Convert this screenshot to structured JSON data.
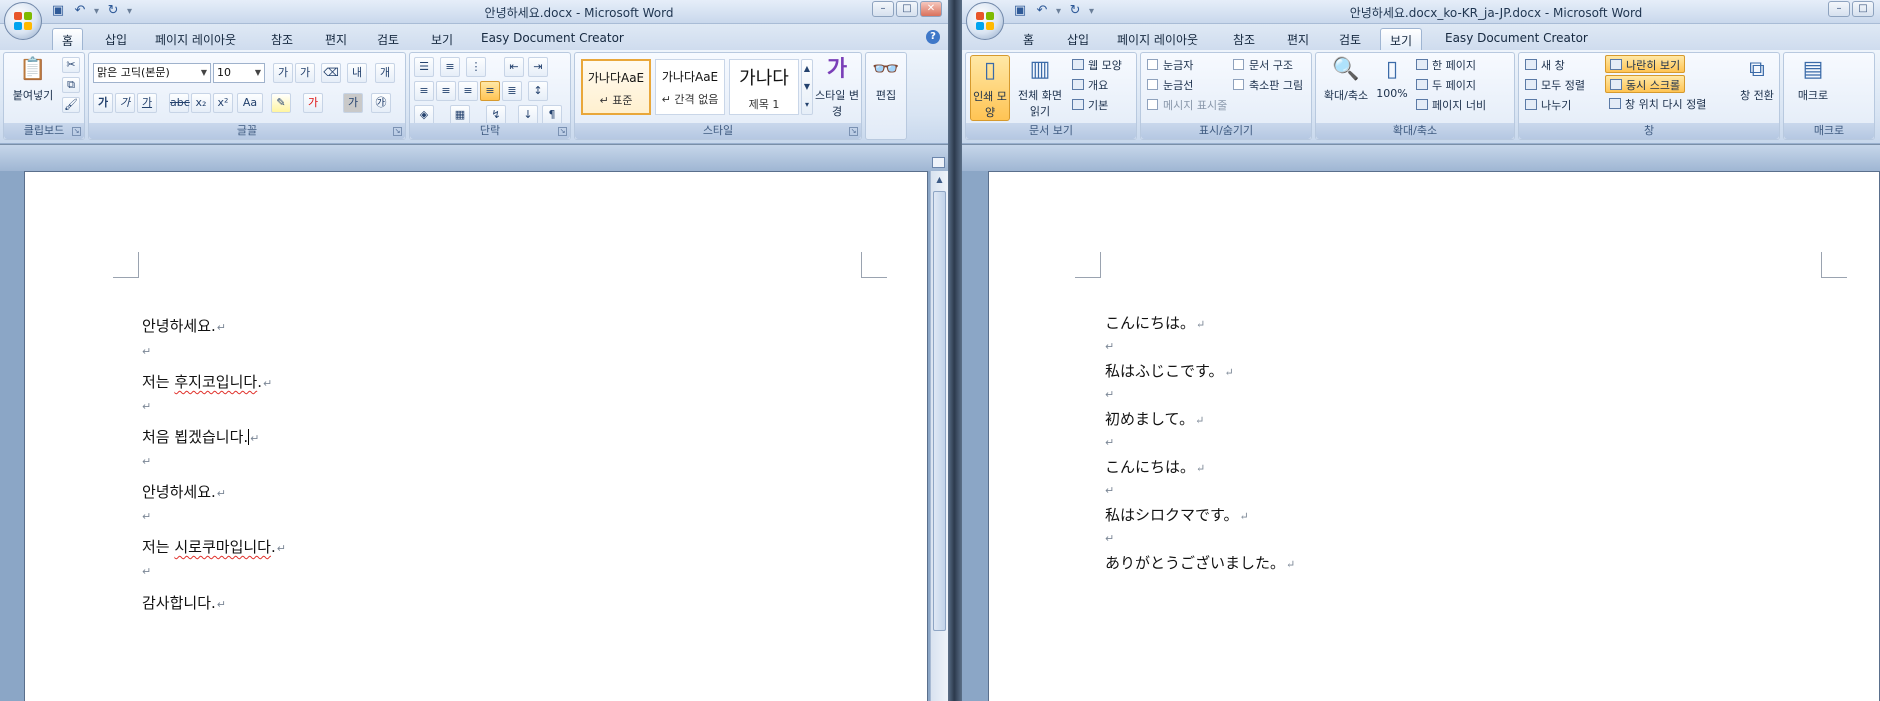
{
  "left": {
    "title": "안녕하세요.docx - Microsoft Word",
    "tabs": [
      "홈",
      "삽입",
      "페이지 레이아웃",
      "참조",
      "편지",
      "검토",
      "보기",
      "Easy Document Creator"
    ],
    "active_tab": "홈",
    "ribbon": {
      "clipboard": {
        "label": "클립보드",
        "paste": "붙여넣기"
      },
      "font": {
        "label": "글꼴",
        "font_name": "맑은 고딕(본문)",
        "font_size": "10"
      },
      "paragraph": {
        "label": "단락"
      },
      "styles": {
        "label": "스타일",
        "items": [
          {
            "preview": "가나다AaE",
            "name": "↵ 표준"
          },
          {
            "preview": "가나다AaE",
            "name": "↵ 간격 없음"
          },
          {
            "preview": "가나다",
            "name": "제목 1"
          }
        ],
        "change_style": "스타일 변경"
      },
      "editing": {
        "label": "편집"
      }
    },
    "document_lines": [
      "안녕하세요.",
      "저는 후지코입니다.",
      "처음 뵙겠습니다.",
      "안녕하세요.",
      "저는 시로쿠마입니다.",
      "감사합니다."
    ],
    "squiggle_words": [
      "후지코입니다",
      "시로쿠마입니다"
    ]
  },
  "right": {
    "title": "안녕하세요.docx_ko-KR_ja-JP.docx - Microsoft Word",
    "tabs": [
      "홈",
      "삽입",
      "페이지 레이아웃",
      "참조",
      "편지",
      "검토",
      "보기",
      "Easy Document Creator"
    ],
    "active_tab": "보기",
    "ribbon": {
      "doc_views": {
        "label": "문서 보기",
        "print_layout": "인쇄 모양",
        "full_screen": "전체 화면 읽기",
        "web_layout": "웹 모양",
        "outline": "개요",
        "draft": "기본"
      },
      "show_hide": {
        "label": "표시/숨기기",
        "ruler": "눈금자",
        "gridlines": "눈금선",
        "message_bar": "메시지 표시줄",
        "document_map": "문서 구조",
        "thumbnails": "축소판 그림"
      },
      "zoom": {
        "label": "확대/축소",
        "zoom": "확대/축소",
        "hundred": "100%",
        "one_page": "한 페이지",
        "two_pages": "두 페이지",
        "page_width": "페이지 너비"
      },
      "window": {
        "label": "창",
        "new_window": "새 창",
        "arrange_all": "모두 정렬",
        "split": "나누기",
        "side_by_side": "나란히 보기",
        "sync_scroll": "동시 스크롤",
        "reset_position": "창 위치 다시 정렬",
        "switch_windows": "창 전환"
      },
      "macros": {
        "label": "매크로",
        "macros": "매크로"
      }
    },
    "document_lines": [
      "こんにちは。",
      "私はふじこです。",
      "初めまして。",
      "こんにちは。",
      "私はシロクマです。",
      "ありがとうございました。"
    ]
  },
  "colors": {
    "accent": "#3f78c8",
    "selected": "#ffc454",
    "squiggle": "#e0302a"
  }
}
